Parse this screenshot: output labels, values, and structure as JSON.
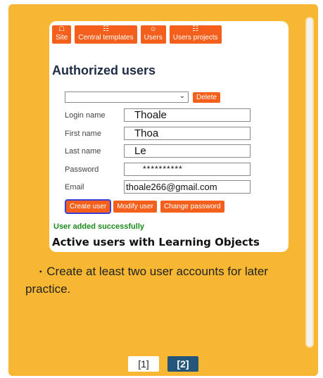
{
  "screenshot": {
    "tabs": [
      {
        "label": "Site",
        "icon": "sitemap-icon",
        "glyph": "☖"
      },
      {
        "label": "Central templates",
        "icon": "document-icon",
        "glyph": "☷"
      },
      {
        "label": "Users",
        "icon": "users-icon",
        "glyph": "☺"
      },
      {
        "label": "Users projects",
        "icon": "document-icon",
        "glyph": "☷"
      }
    ],
    "heading": "Authorized users",
    "user_select": {
      "value": "",
      "chevron": "⌄"
    },
    "delete_label": "Delete",
    "fields": {
      "login_label": "Login name",
      "login_value": "Thoale",
      "first_label": "First name",
      "first_value": "Thoa",
      "last_label": "Last name",
      "last_value": "Le",
      "password_label": "Password",
      "password_value": "**********",
      "email_label": "Email",
      "email_value": "thoale266@gmail.com"
    },
    "actions": {
      "create": "Create user",
      "modify": "Modify user",
      "change_password": "Change password"
    },
    "success_message": "User added successfully",
    "active_users_heading": "Active users with Learning Objects"
  },
  "note": {
    "bullet": "▪",
    "text": "Create at least two user accounts for later practice."
  },
  "pagination": {
    "pages": [
      "[1]",
      "[2]"
    ],
    "current": "[2]"
  },
  "colors": {
    "card_background": "#f7b733",
    "tab_orange": "#f4601b",
    "success_green": "#1b8a1b",
    "current_page": "#23567a"
  }
}
